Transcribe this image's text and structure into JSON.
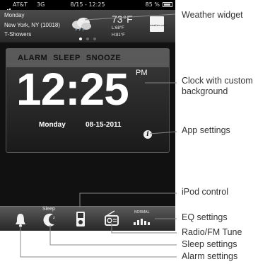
{
  "status_bar": {
    "carrier": "AT&T",
    "network": "3G",
    "time": "8/15 - 12:25",
    "battery": "85 %"
  },
  "weather": {
    "day": "Monday",
    "location": "New York, NY (10018)",
    "condition": "T-Showers",
    "temperature": "73°F",
    "low": "L:68°F",
    "high": "H:81°F",
    "logo_text": "weather.com",
    "icon": "cloud-icon",
    "page_count": 3,
    "active_page": 0
  },
  "clock": {
    "menu": [
      "ALARM",
      "SLEEP",
      "SNOOZE"
    ],
    "time": "12:25",
    "ampm": "PM",
    "day": "Monday",
    "date": "08-15-2011"
  },
  "toolbar": {
    "sleep_label": "Sleep",
    "eq_mode": "NORMAL",
    "icons": [
      "bell-icon",
      "moon-icon",
      "ipod-icon",
      "radio-icon",
      "eq-icon"
    ]
  },
  "callouts": {
    "weather_widget": "Weather widget",
    "clock_line1": "Clock with custom",
    "clock_line2": "background",
    "app_settings": "App settings",
    "ipod_control": "iPod control",
    "eq_settings": "EQ settings",
    "radio": "Radio/FM Tune",
    "sleep": "Sleep settings",
    "alarm": "Alarm settings"
  },
  "colors": {
    "callout_line": "#888888",
    "text": "#333333"
  }
}
